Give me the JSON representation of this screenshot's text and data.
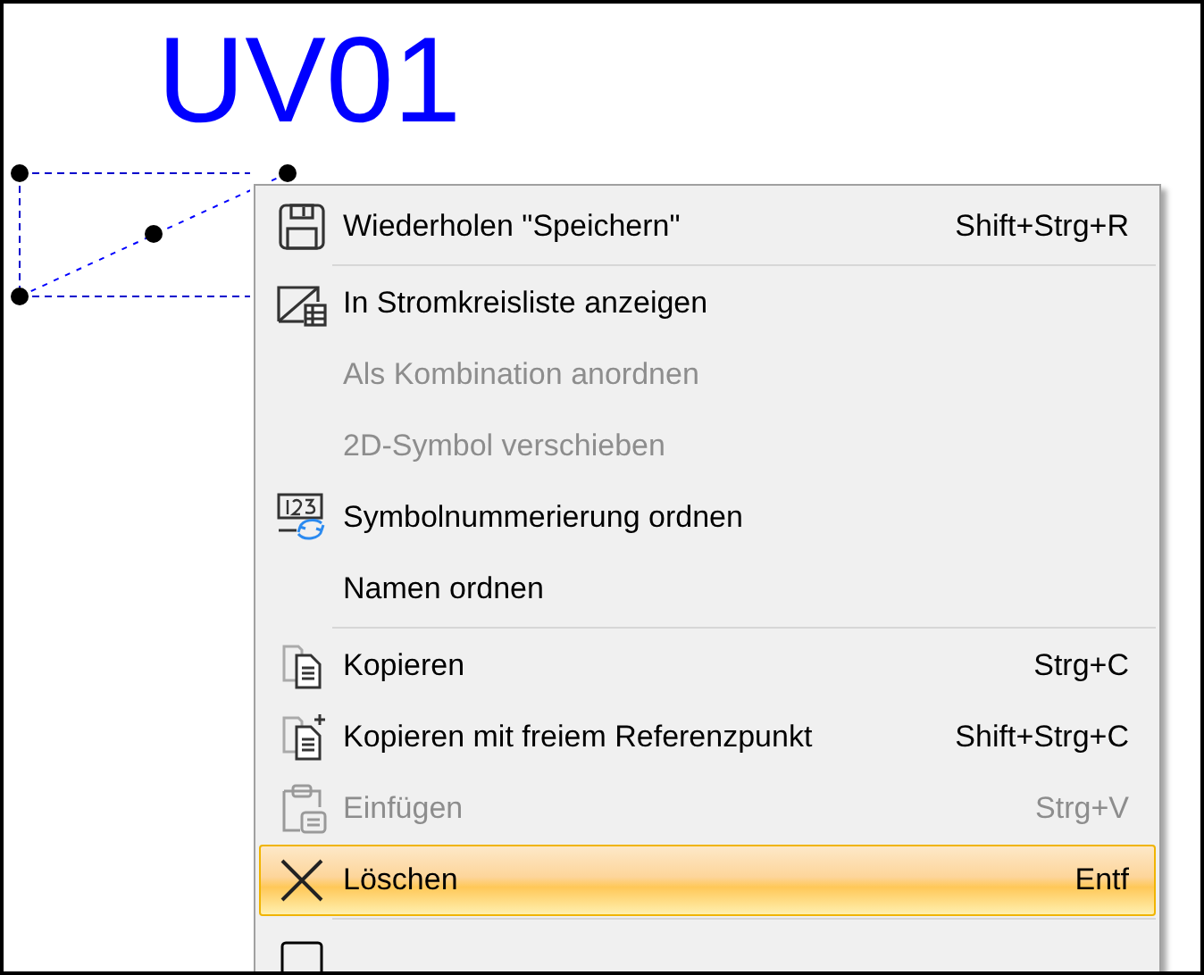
{
  "canvas": {
    "label": "UV01"
  },
  "context_menu": {
    "entries": [
      {
        "kind": "item",
        "label": "Wiederholen \"Speichern\"",
        "shortcut": "Shift+Strg+R",
        "disabled": false,
        "selected": false
      },
      {
        "kind": "separator"
      },
      {
        "kind": "item",
        "label": "In Stromkreisliste anzeigen",
        "disabled": false,
        "selected": false
      },
      {
        "kind": "item",
        "label": "Als Kombination anordnen",
        "disabled": true,
        "selected": false
      },
      {
        "kind": "item",
        "label": "2D-Symbol verschieben",
        "disabled": true,
        "selected": false
      },
      {
        "kind": "item",
        "label": "Symbolnummerierung ordnen",
        "disabled": false,
        "selected": false
      },
      {
        "kind": "item",
        "label": "Namen ordnen",
        "disabled": false,
        "selected": false
      },
      {
        "kind": "separator"
      },
      {
        "kind": "item",
        "label": "Kopieren",
        "shortcut": "Strg+C",
        "disabled": false,
        "selected": false
      },
      {
        "kind": "item",
        "label": "Kopieren mit freiem Referenzpunkt",
        "shortcut": "Shift+Strg+C",
        "disabled": false,
        "selected": false
      },
      {
        "kind": "item",
        "label": "Einfügen",
        "shortcut": "Strg+V",
        "disabled": true,
        "selected": false
      },
      {
        "kind": "item",
        "label": "Löschen",
        "shortcut": "Entf",
        "disabled": false,
        "selected": true
      },
      {
        "kind": "separator"
      },
      {
        "kind": "item",
        "disabled": false,
        "selected": false
      }
    ]
  }
}
